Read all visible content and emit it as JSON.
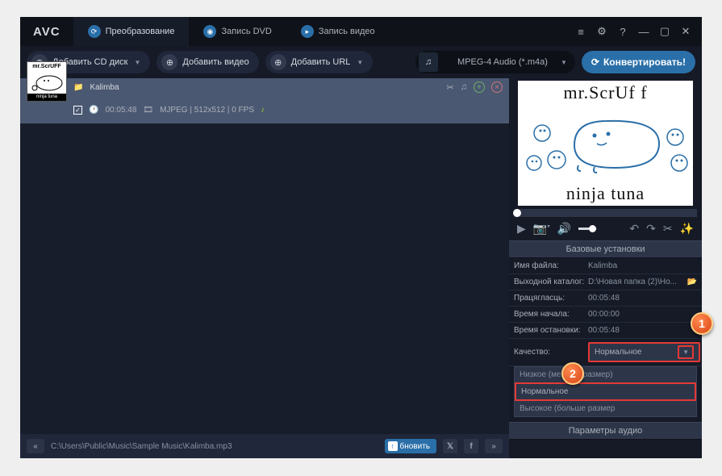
{
  "app": {
    "logo": "AVC"
  },
  "tabs": {
    "convert": "Преобразование",
    "dvd": "Запись DVD",
    "video": "Запись видео"
  },
  "toolbar": {
    "add_cd": "Добавить CD диск",
    "add_video": "Добавить видео",
    "add_url": "Добавить URL",
    "format": "MPEG-4 Audio (*.m4a)",
    "convert": "Конвертировать!"
  },
  "list": {
    "title": "Kalimba",
    "duration": "00:05:48",
    "codec": "MJPEG | 512x512 | 0 FPS",
    "thumb_top": "mr.ScrUFF",
    "thumb_bottom": "ninja tuna"
  },
  "preview": {
    "top": "mr.ScrUf f",
    "bottom": "ninja tuna"
  },
  "settings": {
    "header": "Базовые установки",
    "filename_label": "Имя файла:",
    "filename_value": "Kalimba",
    "output_label": "Выходной каталог:",
    "output_value": "D:\\Новая папка (2)\\Но...",
    "duration_label": "Працягласць:",
    "duration_value": "00:05:48",
    "start_label": "Время начала:",
    "start_value": "00:00:00",
    "stop_label": "Время остановки:",
    "stop_value": "00:05:48",
    "quality_label": "Качество:",
    "quality_value": "Нормальное",
    "quality_options": {
      "low": "Низкое (меньше размер)",
      "normal": "Нормальное",
      "high": "Высокое (больше размер"
    },
    "audio_header": "Параметры аудио"
  },
  "bottombar": {
    "path": "C:\\Users\\Public\\Music\\Sample Music\\Kalimba.mp3",
    "update": "бновить"
  },
  "markers": {
    "one": "1",
    "two": "2"
  }
}
